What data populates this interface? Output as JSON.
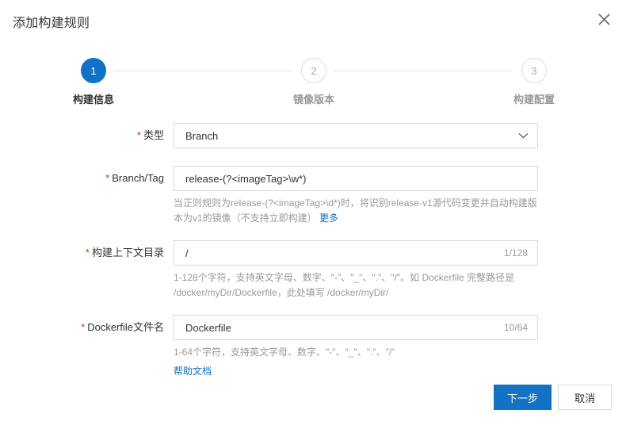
{
  "dialog": {
    "title": "添加构建规则",
    "close_icon": "close-icon"
  },
  "stepper": {
    "steps": [
      {
        "number": "1",
        "label": "构建信息",
        "state": "active"
      },
      {
        "number": "2",
        "label": "镜像版本",
        "state": "inactive"
      },
      {
        "number": "3",
        "label": "构建配置",
        "state": "inactive"
      }
    ]
  },
  "form": {
    "type_field": {
      "label": "类型",
      "required_mark": "*",
      "value": "Branch",
      "arrow_icon": "chevron-down-icon"
    },
    "branch_tag_field": {
      "label": "Branch/Tag",
      "required_mark": "*",
      "value": "release-(?<imageTag>\\w*)",
      "help_text": "当正则规则为release-(?<imageTag>\\d*)时，将识别release-v1源代码变更并自动构建版本为v1的镜像（不支持立即构建）",
      "help_link": "更多"
    },
    "context_dir_field": {
      "label": "构建上下文目录",
      "required_mark": "*",
      "value": "/",
      "counter": "1/128",
      "help_text": "1-128个字符，支持英文字母、数字、\"-\"、\"_\"、\".\"、\"/\"。如 Dockerfile 完整路径是 /docker/myDir/Dockerfile，此处填写 /docker/myDir/"
    },
    "dockerfile_field": {
      "label": "Dockerfile文件名",
      "required_mark": "*",
      "value": "Dockerfile",
      "counter": "10/64",
      "help_text": "1-64个字符，支持英文字母、数字、\"-\"、\"_\"、\".\"、\"/\"",
      "help_doc_link": "帮助文档"
    }
  },
  "footer": {
    "next_label": "下一步",
    "cancel_label": "取消"
  },
  "colors": {
    "primary": "#1272c4",
    "step_active": "#0f72c4",
    "required": "#d93026",
    "link": "#0f72c4",
    "border": "#d9d9d9",
    "muted_text": "#999999"
  }
}
